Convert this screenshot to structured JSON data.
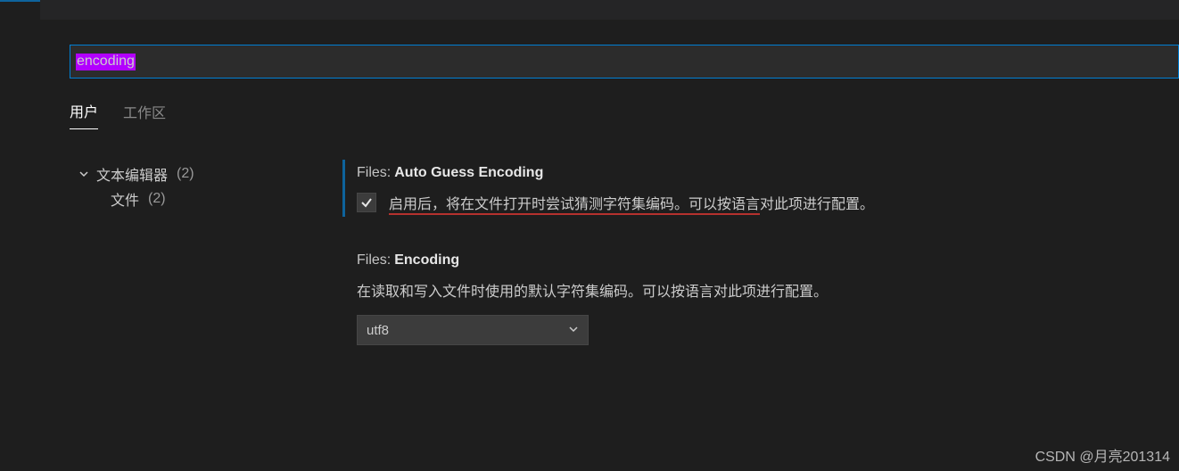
{
  "search": {
    "value": "encoding"
  },
  "tabs": {
    "user": "用户",
    "workspace": "工作区"
  },
  "tree": {
    "textEditor": {
      "label": "文本编辑器",
      "count": "(2)"
    },
    "files": {
      "label": "文件",
      "count": "(2)"
    }
  },
  "settings": {
    "autoGuess": {
      "category": "Files:",
      "name": "Auto Guess Encoding",
      "desc_underlined": "启用后，将在文件打开时尝试猜测字符集编码。可以按语言",
      "desc_tail": "对此项进行配置。"
    },
    "encoding": {
      "category": "Files:",
      "name": "Encoding",
      "desc": "在读取和写入文件时使用的默认字符集编码。可以按语言对此项进行配置。",
      "value": "utf8"
    }
  },
  "watermark": "CSDN @月亮201314"
}
